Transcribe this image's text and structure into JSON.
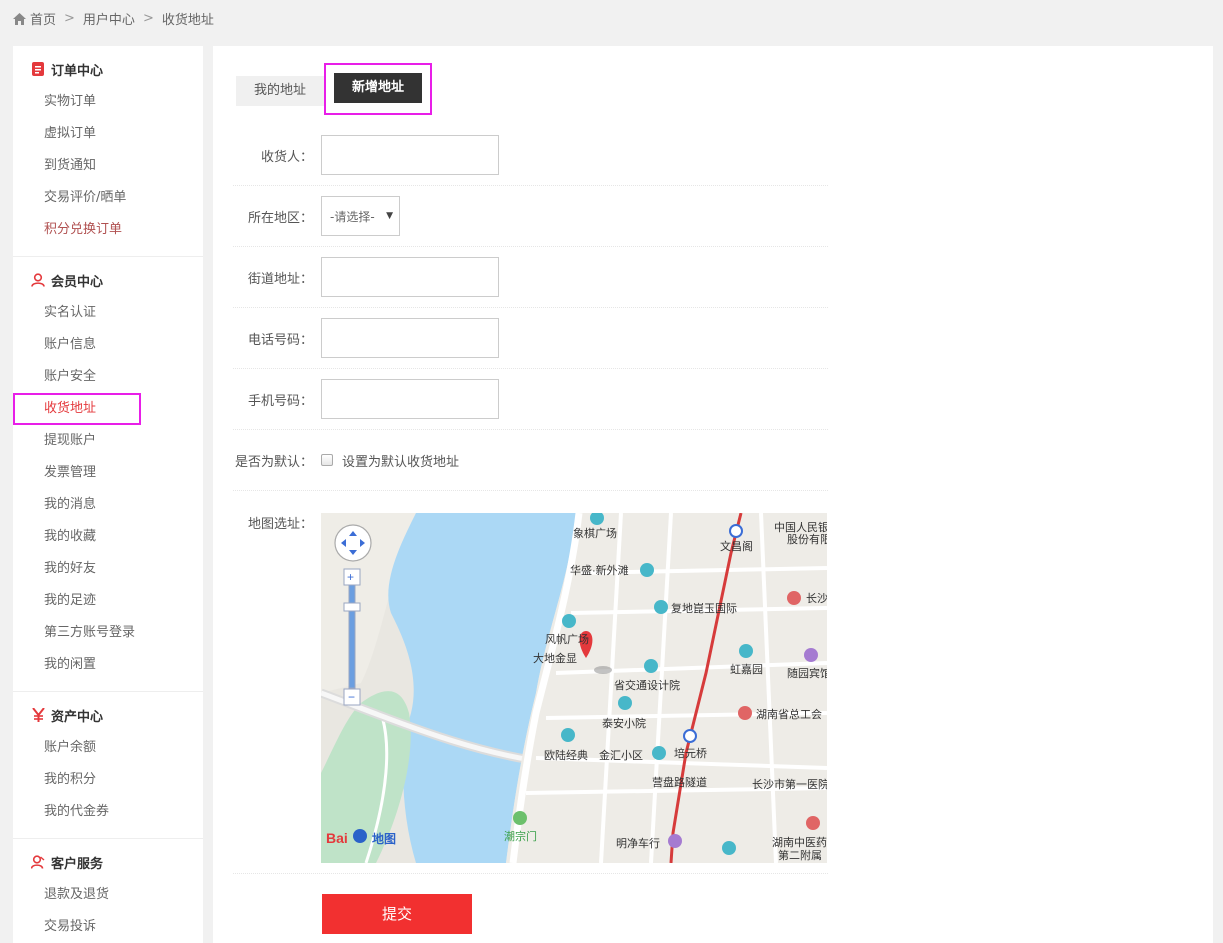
{
  "breadcrumb": {
    "home": "首页",
    "sep": ">",
    "user_center": "用户中心",
    "current": "收货地址"
  },
  "sidebar": {
    "groups": [
      {
        "title": "订单中心",
        "icon": "order-icon",
        "items": [
          "实物订单",
          "虚拟订单",
          "到货通知",
          "交易评价/晒单",
          "积分兑换订单"
        ]
      },
      {
        "title": "会员中心",
        "icon": "member-icon",
        "items": [
          "实名认证",
          "账户信息",
          "账户安全",
          "收货地址",
          "提现账户",
          "发票管理",
          "我的消息",
          "我的收藏",
          "我的好友",
          "我的足迹",
          "第三方账号登录",
          "我的闲置"
        ]
      },
      {
        "title": "资产中心",
        "icon": "yen-icon",
        "items": [
          "账户余额",
          "我的积分",
          "我的代金券"
        ]
      },
      {
        "title": "客户服务",
        "icon": "service-icon",
        "items": [
          "退款及退货",
          "交易投诉"
        ]
      }
    ]
  },
  "tabs": {
    "my_address": "我的地址",
    "new_address": "新增地址"
  },
  "form": {
    "receiver_label": "收货人：",
    "region_label": "所在地区：",
    "region_value": "-请选择-",
    "street_label": "街道地址：",
    "phone_label": "电话号码：",
    "mobile_label": "手机号码：",
    "default_label": "是否为默认：",
    "default_checkbox_label": "设置为默认收货地址",
    "map_label": "地图选址："
  },
  "map": {
    "places": [
      "象棋广场",
      "华盛·新外滩",
      "复地崑玉国际",
      "风帆广场",
      "大地金显",
      "省交通设计院",
      "虹嘉园",
      "泰安小院",
      "欧陆经典",
      "金汇小区",
      "培元桥",
      "营盘路隧道",
      "长沙市第一医院",
      "湖南省总工会",
      "湖南中医药第二附属",
      "明净车行",
      "潮宗门",
      "文昌阁",
      "中国人民银行股份有限",
      "长沙",
      "随园宾馆"
    ],
    "logo": "Baidu地图"
  },
  "submit_label": "提交",
  "colors": {
    "accent": "#f23030",
    "highlight": "#e81ee8",
    "tab_dark": "#333333"
  }
}
